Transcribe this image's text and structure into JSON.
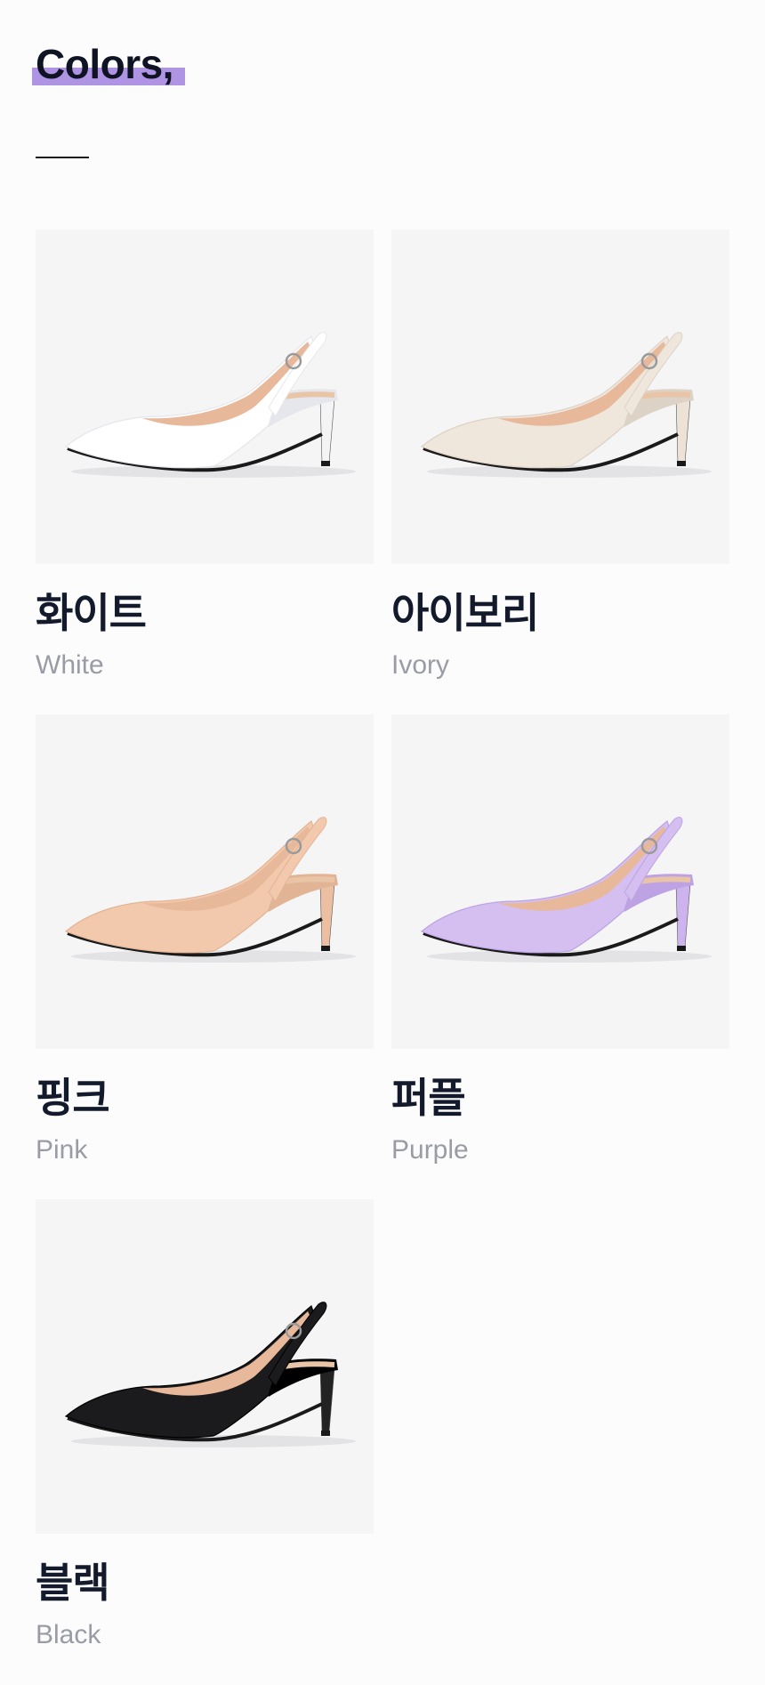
{
  "section": {
    "title": "Colors,"
  },
  "accent_color": "#ae94e3",
  "colors": [
    {
      "name_ko": "화이트",
      "name_en": "White",
      "upper": "#ffffff",
      "upper_shade": "#e6e7ec",
      "heel": "#f4f4f6",
      "icon": "white-shoe-image"
    },
    {
      "name_ko": "아이보리",
      "name_en": "Ivory",
      "upper": "#efe6dc",
      "upper_shade": "#ddd2c6",
      "heel": "#ece2d6",
      "icon": "ivory-shoe-image"
    },
    {
      "name_ko": "핑크",
      "name_en": "Pink",
      "upper": "#f2c9ad",
      "upper_shade": "#e2b496",
      "heel": "#ecbfa2",
      "icon": "pink-shoe-image"
    },
    {
      "name_ko": "퍼플",
      "name_en": "Purple",
      "upper": "#d5bff0",
      "upper_shade": "#bda3e3",
      "heel": "#cdb4ee",
      "icon": "purple-shoe-image"
    },
    {
      "name_ko": "블랙",
      "name_en": "Black",
      "upper": "#1b1b1d",
      "upper_shade": "#000000",
      "heel": "#222224",
      "icon": "black-shoe-image"
    }
  ]
}
